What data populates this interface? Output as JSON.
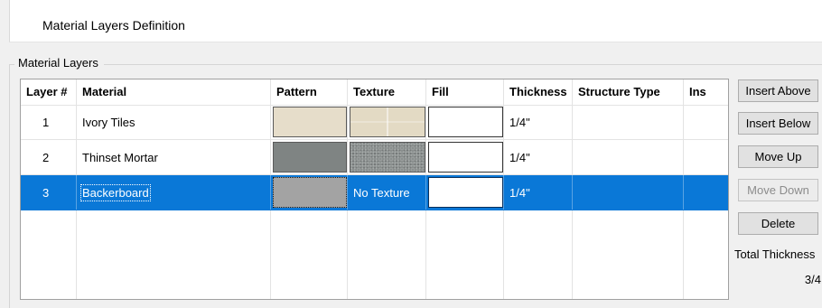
{
  "dialog": {
    "title": "Material Layers Definition"
  },
  "group": {
    "label": "Material Layers"
  },
  "grid": {
    "columns": [
      "Layer #",
      "Material",
      "Pattern",
      "Texture",
      "Fill",
      "Thickness",
      "Structure Type",
      "Ins"
    ],
    "rows": [
      {
        "layer": "1",
        "material": "Ivory Tiles",
        "pattern_color": "#e6ddca",
        "texture_color": "#e3dac4",
        "texture": "",
        "thickness": "1/4\"",
        "structure_type": "",
        "ins": "",
        "selected": false
      },
      {
        "layer": "2",
        "material": "Thinset Mortar",
        "pattern_color": "#7f8483",
        "texture_color": "#8a8f8e",
        "texture": "",
        "thickness": "1/4\"",
        "structure_type": "",
        "ins": "",
        "selected": false
      },
      {
        "layer": "3",
        "material": "Backerboard",
        "pattern_color": "#a3a3a3",
        "texture_color": "",
        "texture": "No Texture",
        "thickness": "1/4\"",
        "structure_type": "",
        "ins": "",
        "selected": true
      }
    ]
  },
  "buttons": {
    "insert_above": "Insert Above",
    "insert_below": "Insert Below",
    "move_up": "Move Up",
    "move_down": "Move Down",
    "delete": "Delete"
  },
  "total": {
    "label": "Total Thickness",
    "value": "3/4"
  },
  "colors": {
    "selection": "#0a78d7"
  }
}
